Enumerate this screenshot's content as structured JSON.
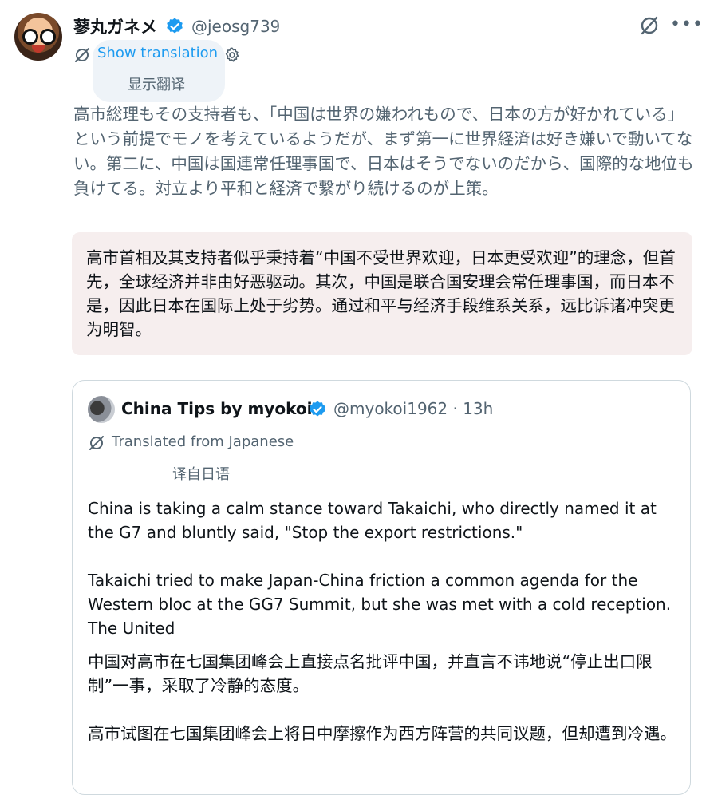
{
  "author": {
    "display_name": "蓼丸ガネメ",
    "handle": "@jeosg739"
  },
  "translation": {
    "show_label": "Show translation",
    "overlay_zh": "显示翻译"
  },
  "tweet": {
    "text_ja": "高市総理もその支持者も、「中国は世界の嫌われもので、日本の方が好かれている」という前提でモノを考えているようだが、まず第一に世界経済は好き嫌いで動いてない。第二に、中国は国連常任理事国で、日本はそうでないのだから、国際的な地位も負けてる。対立より平和と経済で繋がり続けるのが上策。",
    "text_zh": "高市首相及其支持者似乎秉持着“中国不受世界欢迎，日本更受欢迎”的理念，但首先，全球经济并非由好恶驱动。其次，中国是联合国安理会常任理事国，而日本不是，因此日本在国际上处于劣势。通过和平与经济手段维系关系，远比诉诸冲突更为明智。"
  },
  "quote": {
    "display_name": "China Tips by myokoi",
    "handle_time": "@myokoi1962 · 13h",
    "translated_label": "Translated from Japanese",
    "translated_label_zh": "译自日语",
    "en_para1": "China is taking a calm stance toward Takaichi, who directly named it at the G7 and bluntly said, \"Stop the export restrictions.\"",
    "en_para2": "Takaichi tried to make Japan-China friction a common agenda for the Western bloc at the GG7 Summit, but she was met with a cold reception. The United",
    "zh_para1": "中国对高市在七国集团峰会上直接点名批评中国，并直言不讳地说“停止出口限制”一事，采取了冷静的态度。",
    "zh_para2": "高市试图在七国集团峰会上将日中摩擦作为西方阵营的共同议题，但却遭到冷遇。"
  },
  "colors": {
    "link": "#1d9bf0",
    "secondary_text": "#536471",
    "verified": "#1d9bf0",
    "translation_box": "#f6eeee"
  },
  "icons": [
    "avatar",
    "verified-badge-icon",
    "grok-icon",
    "more-icon",
    "translate-icon",
    "gear-icon"
  ]
}
